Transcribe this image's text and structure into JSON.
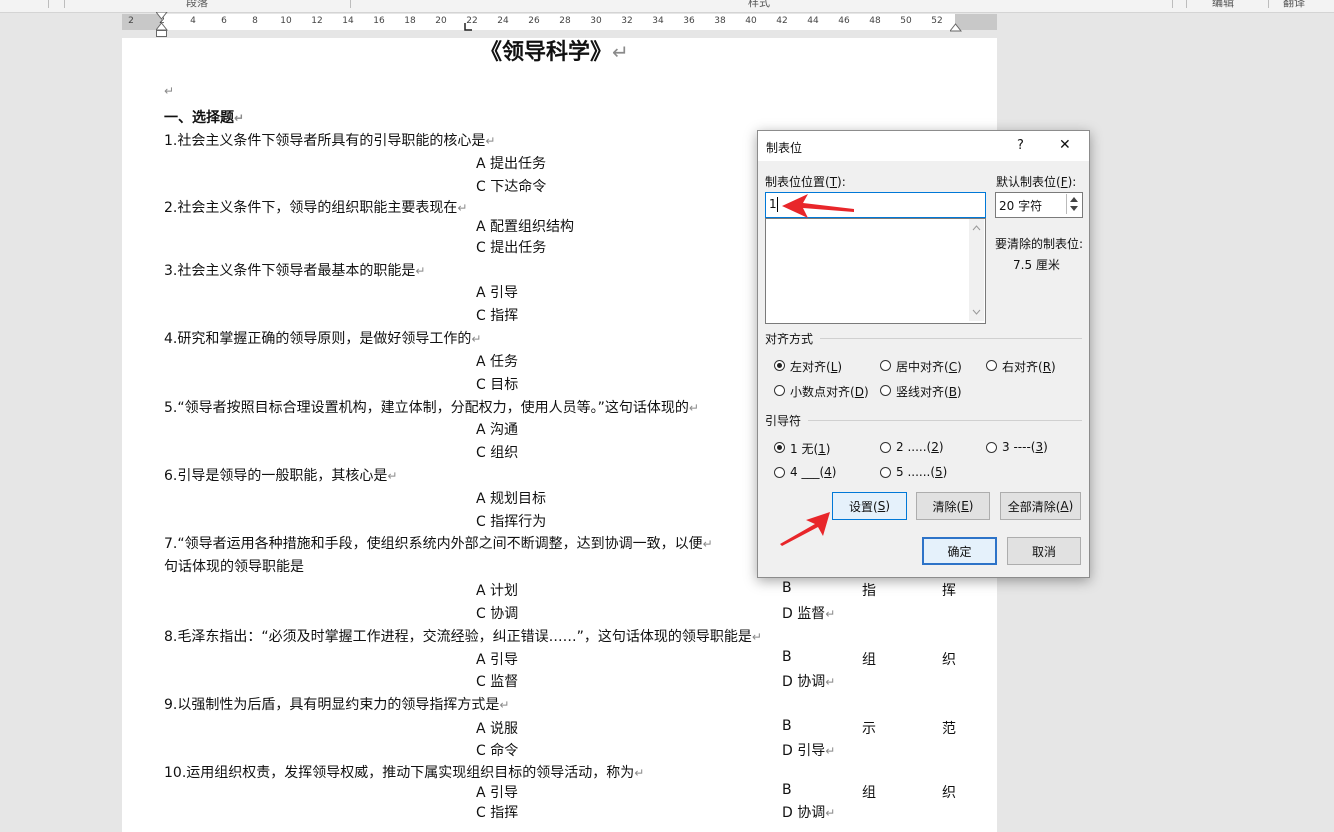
{
  "ribbon": {
    "groups": [
      "段落",
      "样式",
      "编辑",
      "翻译"
    ]
  },
  "ruler": {
    "ticks": [
      "2",
      "2",
      "4",
      "6",
      "8",
      "10",
      "12",
      "14",
      "16",
      "18",
      "20",
      "22",
      "24",
      "26",
      "28",
      "30",
      "32",
      "34",
      "36",
      "38",
      "40",
      "42",
      "44",
      "46",
      "48",
      "50",
      "52"
    ]
  },
  "document": {
    "title": "《领导科学》",
    "return_mark": "↵",
    "section_heading": "一、选择题",
    "lines": [
      {
        "text": "1.社会主义条件下领导者所具有的引导职能的核心是"
      },
      {
        "text": "A 提出任务"
      },
      {
        "text": "C 下达命令"
      },
      {
        "text": "2.社会主义条件下，领导的组织职能主要表现在"
      },
      {
        "text": "A 配置组织结构"
      },
      {
        "text": "C 提出任务"
      },
      {
        "text": "3.社会主义条件下领导者最基本的职能是"
      },
      {
        "text": "A 引导"
      },
      {
        "text": "C 指挥"
      },
      {
        "text": "4.研究和掌握正确的领导原则，是做好领导工作的"
      },
      {
        "text": "A 任务"
      },
      {
        "text": "C 目标"
      },
      {
        "text": "5.“领导者按照目标合理设置机构，建立体制，分配权力，使用人员等。”这句话体现的"
      },
      {
        "text": "A 沟通"
      },
      {
        "text": "C 组织"
      },
      {
        "text": "6.引导是领导的一般职能，其核心是"
      },
      {
        "text": "A 规划目标"
      },
      {
        "text": "C 指挥行为"
      },
      {
        "text": "7.“领导者运用各种措施和手段，使组织系统内外部之间不断调整，达到协调一致，以便"
      },
      {
        "text": "句话体现的领导职能是"
      },
      {
        "text": "A 计划"
      },
      {
        "text": "C 协调"
      },
      {
        "text": "8.毛泽东指出：“必须及时掌握工作进程，交流经验，纠正错误……”，这句话体现的领导职能是"
      },
      {
        "text": "A 引导"
      },
      {
        "text": "C 监督"
      },
      {
        "text": "9.以强制性为后盾，具有明显约束力的领导指挥方式是"
      },
      {
        "text": "A 说服"
      },
      {
        "text": "C 命令"
      },
      {
        "text": "10.运用组织权责，发挥领导权威，推动下属实现组织目标的领导活动，称为"
      },
      {
        "text": "A 引导"
      },
      {
        "text": "C 指挥"
      }
    ],
    "right_col": [
      {
        "b": "B",
        "c1": "指",
        "c2": "挥"
      },
      {
        "d": "D 监督"
      },
      {
        "b": "B",
        "c1": "组",
        "c2": "织"
      },
      {
        "d": "D 协调"
      },
      {
        "b": "B",
        "c1": "示",
        "c2": "范"
      },
      {
        "d": "D 引导"
      },
      {
        "b": "B",
        "c1": "组",
        "c2": "织"
      },
      {
        "d": "D 协调"
      }
    ]
  },
  "dialog": {
    "title": "制表位",
    "help": "?",
    "close": "✕",
    "tab_position_label": "制表位位置(",
    "tab_position_key": "T",
    "tab_position_value": "1",
    "default_tab_label": "默认制表位(",
    "default_tab_key": "F",
    "default_tab_value": "20 字符",
    "clear_label": "要清除的制表位:",
    "clear_value": "7.5 厘米",
    "alignment_label": "对齐方式",
    "alignment_options": [
      {
        "text": "左对齐(",
        "key": "L",
        "checked": true
      },
      {
        "text": "居中对齐(",
        "key": "C",
        "checked": false
      },
      {
        "text": "右对齐(",
        "key": "R",
        "checked": false
      },
      {
        "text": "小数点对齐(",
        "key": "D",
        "checked": false
      },
      {
        "text": "竖线对齐(",
        "key": "B",
        "checked": false
      }
    ],
    "leader_label": "引导符",
    "leader_options": [
      {
        "text": "1 无(",
        "key": "1",
        "checked": true
      },
      {
        "text": "2 .....(",
        "key": "2",
        "checked": false
      },
      {
        "text": "3 ----(",
        "key": "3",
        "checked": false
      },
      {
        "text": "4 ___(",
        "key": "4",
        "checked": false
      },
      {
        "text": "5 ......(",
        "key": "5",
        "checked": false
      }
    ],
    "set_button": {
      "text": "设置(",
      "key": "S"
    },
    "clear_button": {
      "text": "清除(",
      "key": "E"
    },
    "clear_all_button": {
      "text": "全部清除(",
      "key": "A"
    },
    "ok_button": "确定",
    "cancel_button": "取消",
    "paren_close": ")",
    "colon": "):"
  },
  "colors": {
    "annotation_arrow": "#e8262a",
    "primary_border": "#2d73c8"
  }
}
